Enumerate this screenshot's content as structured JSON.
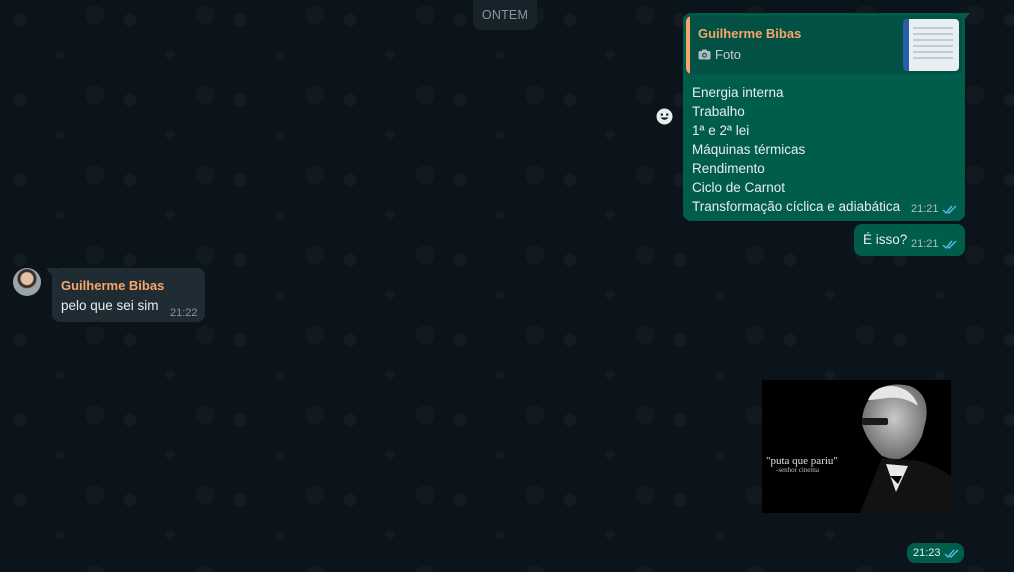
{
  "date_separator": "ONTEM",
  "messages": {
    "outgoing_1": {
      "quote": {
        "author": "Guilherme Bibas",
        "type_label": "Foto"
      },
      "lines": [
        "Energia interna",
        "Trabalho",
        "1ª e 2ª lei",
        "Máquinas térmicas",
        "Rendimento",
        "Ciclo de Carnot",
        "Transformação cíclica e adiabática"
      ],
      "time": "21:21"
    },
    "outgoing_2": {
      "text": "É isso?",
      "time": "21:21"
    },
    "incoming_1": {
      "author": "Guilherme Bibas",
      "text": "pelo que sei sim",
      "time": "21:22"
    },
    "outgoing_image": {
      "caption_line1": "\"puta que pariu\"",
      "caption_line2": "-senhor cinema",
      "time": "21:23"
    }
  },
  "colors": {
    "background": "#0b141a",
    "outgoing_bubble": "#005c4b",
    "incoming_bubble": "#202c33",
    "author_accent": "#f7a569",
    "read_tick": "#53bdeb"
  },
  "icons": [
    "camera-icon",
    "double-check-icon",
    "emoji-reaction-icon"
  ]
}
